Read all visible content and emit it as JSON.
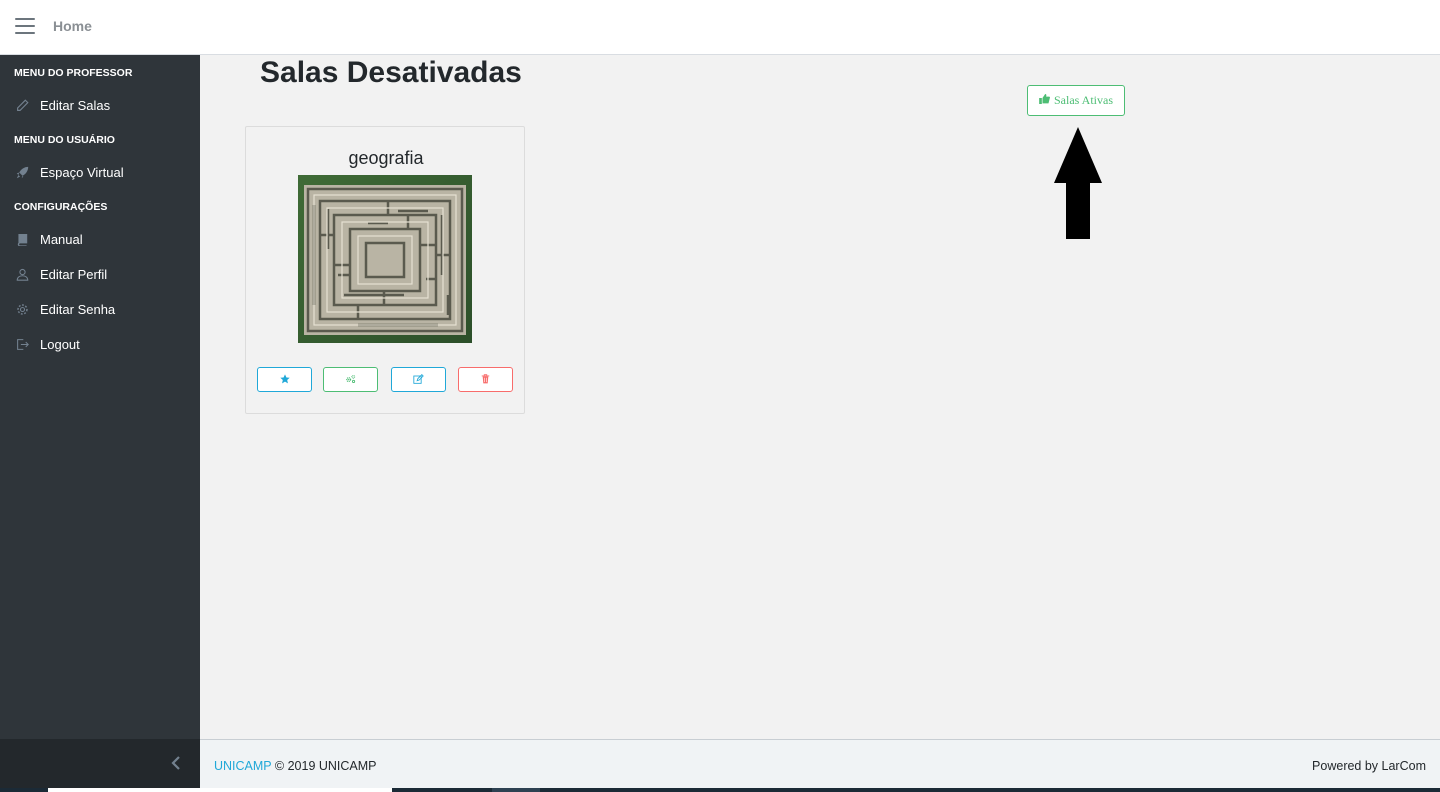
{
  "header": {
    "menu_icon": "hamburger-icon",
    "home_label": "Home"
  },
  "sidebar": {
    "sections": [
      {
        "title": "MENU DO PROFESSOR",
        "items": [
          {
            "label": "Editar Salas",
            "icon": "pencil-icon"
          }
        ]
      },
      {
        "title": "MENU DO USUÁRIO",
        "items": [
          {
            "label": "Espaço Virtual",
            "icon": "rocket-icon"
          }
        ]
      },
      {
        "title": "CONFIGURAÇÕES",
        "items": [
          {
            "label": "Manual",
            "icon": "book-icon"
          },
          {
            "label": "Editar Perfil",
            "icon": "user-icon"
          },
          {
            "label": "Editar Senha",
            "icon": "gear-icon"
          },
          {
            "label": "Logout",
            "icon": "logout-icon"
          }
        ]
      }
    ],
    "collapse_icon": "chevron-left-icon"
  },
  "main": {
    "page_title": "Salas Desativadas",
    "salas_ativas_button": {
      "label": "Salas Ativas",
      "icon": "thumbs-up-icon"
    },
    "annotation_icon": "up-arrow-icon",
    "rooms": [
      {
        "name": "geografia",
        "image": "maze-image",
        "actions": [
          {
            "icon": "star-icon",
            "color": "#20a8d8"
          },
          {
            "icon": "gears-icon",
            "color": "#4dbd74"
          },
          {
            "icon": "edit-icon",
            "color": "#20a8d8"
          },
          {
            "icon": "trash-icon",
            "color": "#f86c6b"
          }
        ]
      }
    ]
  },
  "footer": {
    "brand": "UNICAMP",
    "copyright": "© 2019 UNICAMP",
    "powered_by": "Powered by LarCom"
  },
  "colors": {
    "sidebar_bg": "#2f353a",
    "primary": "#20a8d8",
    "success": "#4dbd74",
    "danger": "#f86c6b"
  }
}
